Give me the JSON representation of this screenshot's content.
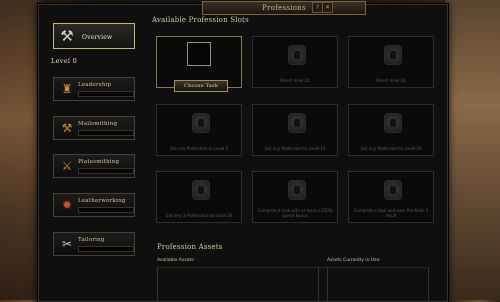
{
  "window": {
    "title": "Professions",
    "help_icon": "?",
    "close_icon": "✕"
  },
  "sidebar": {
    "overview_label": "Overview",
    "level_label": "Level 0",
    "items": [
      {
        "label": "Leadership",
        "icon": "leadership-icon",
        "glyph": "♜",
        "progress": 0
      },
      {
        "label": "Mailsmithing",
        "icon": "mailsmithing-icon",
        "glyph": "⚒",
        "progress": 0
      },
      {
        "label": "Platesmithing",
        "icon": "platesmithing-icon",
        "glyph": "⚔",
        "progress": 0
      },
      {
        "label": "Leatherworking",
        "icon": "leatherworking-icon",
        "glyph": "✹",
        "progress": 0
      },
      {
        "label": "Tailoring",
        "icon": "tailoring-icon",
        "glyph": "✂",
        "progress": 0
      }
    ]
  },
  "slots": {
    "title": "Available Profession Slots",
    "choose_task_label": "Choose Task",
    "items": [
      {
        "text": ""
      },
      {
        "text": "Reach level 20"
      },
      {
        "text": "Reach level 40"
      },
      {
        "text": "Get any Profession to Level 5"
      },
      {
        "text": "Get any Profession to Level 10"
      },
      {
        "text": "Get any Profession to Level 20"
      },
      {
        "text": "Get any 3 Professions to Level 20"
      },
      {
        "text": "Complete a task with at least a 150% speed bonus"
      },
      {
        "text": "Complete a task and earn the Rank 3 result"
      }
    ]
  },
  "assets": {
    "title": "Profession Assets",
    "available_label": "Available Assets:",
    "in_use_label": "Assets Currently in Use:"
  },
  "colors": {
    "gold_text": "#d6c49a",
    "frame_gold": "#c8b37a",
    "window_bg": "#0f0f10"
  }
}
